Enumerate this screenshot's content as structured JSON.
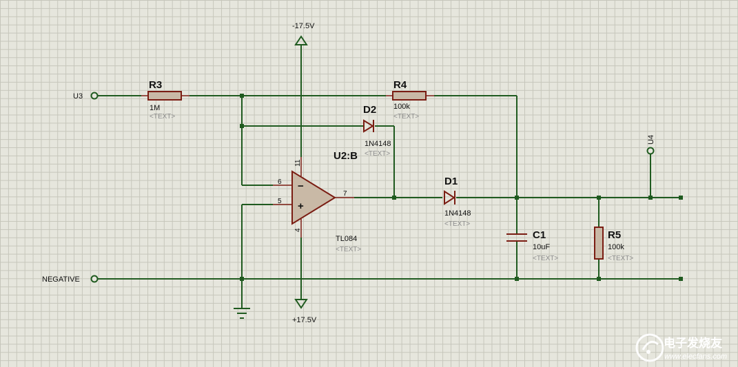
{
  "power": {
    "top": "-17.5V",
    "bottom": "+17.5V"
  },
  "nets": {
    "in": "U3",
    "neg": "NEGATIVE",
    "out": "U4"
  },
  "r3": {
    "ref": "R3",
    "value": "1M",
    "text": "<TEXT>"
  },
  "r4": {
    "ref": "R4",
    "value": "100k",
    "text": "<TEXT>"
  },
  "d2": {
    "ref": "D2",
    "value": "1N4148",
    "text": "<TEXT>"
  },
  "d1": {
    "ref": "D1",
    "value": "1N4148",
    "text": "<TEXT>"
  },
  "u2": {
    "ref": "U2:B",
    "value": "TL084",
    "text": "<TEXT>",
    "pin_minus": "6",
    "pin_plus": "5",
    "pin_out": "7",
    "pin_vtop": "11",
    "pin_vbot": "4",
    "minus_sign": "−",
    "plus_sign": "+"
  },
  "c1": {
    "ref": "C1",
    "value": "10uF",
    "text": "<TEXT>"
  },
  "r5": {
    "ref": "R5",
    "value": "100k",
    "text": "<TEXT>"
  },
  "watermark": {
    "cn": "电子发烧友",
    "url": "www.elecfans.com"
  },
  "colors": {
    "wire": "#1f5a1f",
    "component": "#7a1c12",
    "grid": "#c6c6bb",
    "background": "#e6e6dd"
  }
}
